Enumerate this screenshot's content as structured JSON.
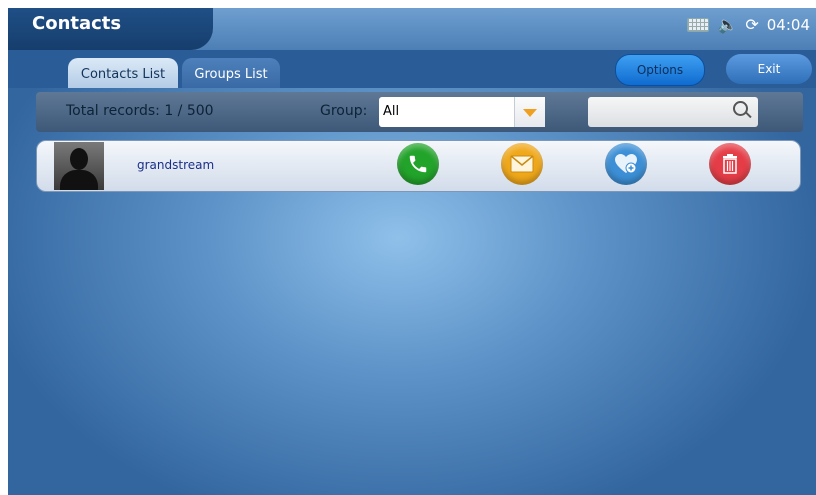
{
  "header": {
    "title": "Contacts",
    "clock": "04:04",
    "status_icons": [
      "keyboard-icon",
      "volume-icon",
      "sync-icon"
    ]
  },
  "tabs": [
    {
      "label": "Contacts List",
      "active": true
    },
    {
      "label": "Groups List",
      "active": false
    }
  ],
  "toolbar": {
    "options_label": "Options",
    "exit_label": "Exit"
  },
  "filter": {
    "records_text": "Total records: 1 / 500",
    "group_label": "Group:",
    "group_value": "All",
    "search_value": ""
  },
  "contacts": [
    {
      "name": "grandstream",
      "actions": [
        "call",
        "message",
        "favorite",
        "delete"
      ]
    }
  ],
  "colors": {
    "accent": "#0f6bd0",
    "call": "#22a32a",
    "message": "#f0a81a",
    "favorite": "#3c8fd6",
    "delete": "#e53d47"
  }
}
